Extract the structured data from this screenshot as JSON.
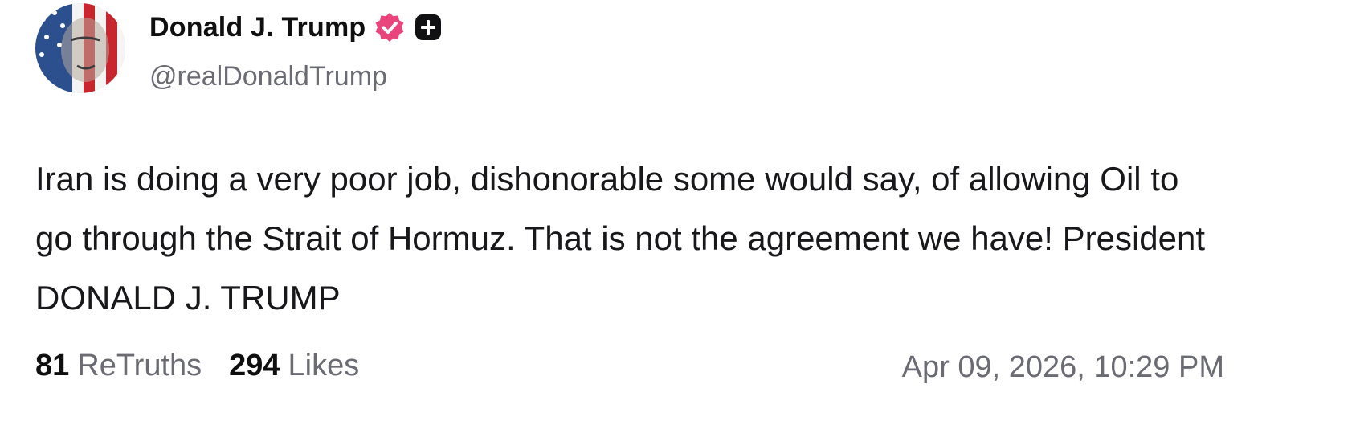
{
  "author": {
    "display_name": "Donald J. Trump",
    "handle": "@realDonaldTrump",
    "verified_icon": "verified-badge-icon",
    "plus_icon": "plus-badge-icon",
    "badge_color": "#e9457c"
  },
  "post": {
    "text": "Iran is doing a very poor job, dishonorable some would say, of allowing Oil to go through the Strait of Hormuz. That is not the agreement we have! President DONALD J. TRUMP",
    "timestamp": "Apr 09, 2026, 10:29 PM"
  },
  "stats": {
    "retruths_count": "81",
    "retruths_label": "ReTruths",
    "likes_count": "294",
    "likes_label": "Likes"
  }
}
